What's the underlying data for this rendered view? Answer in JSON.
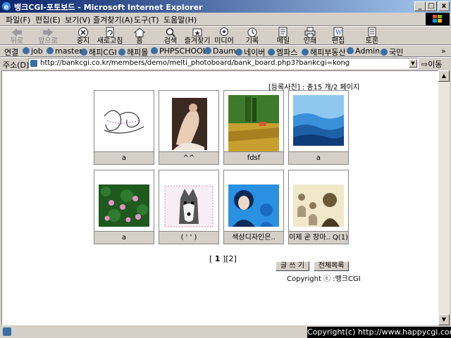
{
  "window": {
    "title": "뱅크CGI-포토보드 - Microsoft Internet Explorer",
    "controls": {
      "minimize": "_",
      "maximize": "□",
      "close": "x"
    }
  },
  "menu": [
    "파일(F)",
    "편집(E)",
    "보기(V)",
    "즐겨찾기(A)",
    "도구(T)",
    "도움말(H)"
  ],
  "toolbar": [
    {
      "label": "뒤로",
      "icon": "back-arrow-icon",
      "disabled": true
    },
    {
      "label": "앞으로",
      "icon": "forward-arrow-icon",
      "disabled": true
    },
    {
      "label": "중지",
      "icon": "stop-icon",
      "disabled": false
    },
    {
      "label": "새로고침",
      "icon": "refresh-icon",
      "disabled": false
    },
    {
      "label": "홈",
      "icon": "home-icon",
      "disabled": false
    },
    {
      "label": "검색",
      "icon": "search-icon",
      "disabled": false
    },
    {
      "label": "즐겨찾기",
      "icon": "favorites-icon",
      "disabled": false
    },
    {
      "label": "미디어",
      "icon": "media-icon",
      "disabled": false
    },
    {
      "label": "기록",
      "icon": "history-icon",
      "disabled": false
    },
    {
      "label": "메일",
      "icon": "mail-icon",
      "disabled": false
    },
    {
      "label": "인쇄",
      "icon": "print-icon",
      "disabled": false
    },
    {
      "label": "편집",
      "icon": "edit-icon",
      "disabled": false
    },
    {
      "label": "토론",
      "icon": "discuss-icon",
      "disabled": false
    }
  ],
  "links": {
    "label": "연결",
    "items": [
      "job",
      "master",
      "해피CGI",
      "해피몰",
      "PHPSCHOOL",
      "Daum",
      "네이버",
      "엠파스",
      "해피부동산",
      "Admin",
      "국민"
    ],
    "more": "»"
  },
  "address": {
    "label": "주소(D)",
    "url": "http://bankcgi.co.kr/members/demo/melti_photoboard/bank_board.php3?bankcgi=kong",
    "go_label": "이동"
  },
  "board": {
    "count_text": "[등록사진] : 총15 개/2 페이지",
    "photos": [
      {
        "caption": "a",
        "thumb": "sketch"
      },
      {
        "caption": "^^",
        "thumb": "person"
      },
      {
        "caption": "fdsf",
        "thumb": "landscape"
      },
      {
        "caption": "a",
        "thumb": "mountains"
      },
      {
        "caption": "a",
        "thumb": "flowers"
      },
      {
        "caption": "( ' ' )",
        "thumb": "dog"
      },
      {
        "caption": "색상디자인은..",
        "thumb": "portrait"
      },
      {
        "caption": "이제 곧 장마.. Q(1)",
        "thumb": "vintage"
      }
    ],
    "pager": {
      "open": "[",
      "current": "1",
      "close": "]",
      "next": "[2]"
    },
    "write_button": "글 쓰 기",
    "list_button": "전체목록",
    "copyright": "Copyright ⓒ :뱅크CGI"
  },
  "status": {
    "right_text": "Copyright(c) http://www.happycgi.com"
  },
  "colors": {
    "titlebar_start": "#0a246a",
    "titlebar_end": "#a6caf0",
    "chrome": "#d4d0c8"
  }
}
